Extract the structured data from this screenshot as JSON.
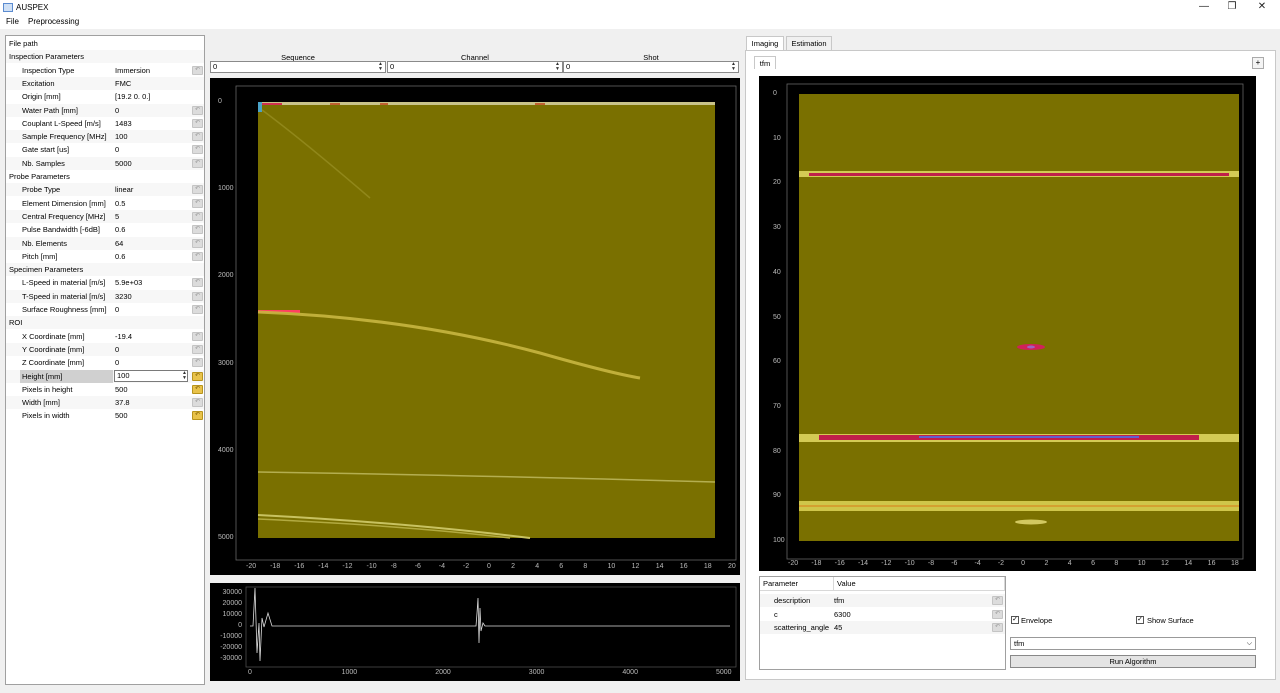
{
  "window": {
    "title": "AUSPEX",
    "minimize": "—",
    "maximize": "❐",
    "close": "✕"
  },
  "menu": {
    "file": "File",
    "preprocessing": "Preprocessing"
  },
  "params": {
    "rows": [
      {
        "label": "File path",
        "value": "",
        "group": true
      },
      {
        "label": "Inspection Parameters",
        "value": "",
        "group": true
      },
      {
        "label": "Inspection Type",
        "value": "Immersion",
        "reset": true
      },
      {
        "label": "Excitation",
        "value": "FMC"
      },
      {
        "label": "Origin [mm]",
        "value": "[19.2  0.  0.]"
      },
      {
        "label": "Water Path [mm]",
        "value": "0",
        "reset": true
      },
      {
        "label": "Couplant L-Speed [m/s]",
        "value": "1483",
        "reset": true
      },
      {
        "label": "Sample Frequency [MHz]",
        "value": "100",
        "reset": true
      },
      {
        "label": "Gate start [us]",
        "value": "0",
        "reset": true
      },
      {
        "label": "Nb. Samples",
        "value": "5000",
        "reset": true
      },
      {
        "label": "Probe Parameters",
        "value": "",
        "group": true
      },
      {
        "label": "Probe Type",
        "value": "linear",
        "reset": true
      },
      {
        "label": "Element Dimension [mm]",
        "value": "0.5",
        "reset": true
      },
      {
        "label": "Central Frequency [MHz]",
        "value": "5",
        "reset": true
      },
      {
        "label": "Pulse Bandwidth [-6dB]",
        "value": "0.6",
        "reset": true
      },
      {
        "label": "Nb. Elements",
        "value": "64",
        "reset": true
      },
      {
        "label": "Pitch [mm]",
        "value": "0.6",
        "reset": true
      },
      {
        "label": "Specimen Parameters",
        "value": "",
        "group": true
      },
      {
        "label": "L-Speed in material [m/s]",
        "value": "5.9e+03",
        "reset": true
      },
      {
        "label": "T-Speed in material [m/s]",
        "value": "3230",
        "reset": true
      },
      {
        "label": "Surface Roughness [mm]",
        "value": "0",
        "reset": true
      },
      {
        "label": "ROI",
        "value": "",
        "group": true
      },
      {
        "label": "X Coordinate [mm]",
        "value": "-19.4",
        "reset": true
      },
      {
        "label": "Y Coordinate [mm]",
        "value": "0",
        "reset": true
      },
      {
        "label": "Z Coordinate [mm]",
        "value": "0",
        "reset": true
      },
      {
        "label": "Height [mm]",
        "value": "100",
        "reset": true,
        "active": true,
        "editing": true
      },
      {
        "label": "Pixels in height",
        "value": "500",
        "reset": true,
        "active": true
      },
      {
        "label": "Width [mm]",
        "value": "37.8",
        "reset": true
      },
      {
        "label": "Pixels in width",
        "value": "500",
        "reset": true,
        "active": true
      }
    ]
  },
  "selectors": {
    "sequence_label": "Sequence",
    "sequence_value": "0",
    "channel_label": "Channel",
    "channel_value": "0",
    "shot_label": "Shot",
    "shot_value": "0"
  },
  "bscan": {
    "y_ticks": [
      "0",
      "1000",
      "2000",
      "3000",
      "4000",
      "5000"
    ],
    "x_ticks": [
      "-20",
      "-18",
      "-16",
      "-14",
      "-12",
      "-10",
      "-8",
      "-6",
      "-4",
      "-2",
      "0",
      "2",
      "4",
      "6",
      "8",
      "10",
      "12",
      "14",
      "16",
      "18",
      "20"
    ]
  },
  "ascan": {
    "y_ticks": [
      "30000",
      "20000",
      "10000",
      "0",
      "-10000",
      "-20000",
      "-30000"
    ],
    "x_ticks": [
      "0",
      "1000",
      "2000",
      "3000",
      "4000",
      "5000"
    ]
  },
  "tabs": {
    "imaging": "Imaging",
    "estimation": "Estimation",
    "tfm": "tfm",
    "add": "+"
  },
  "tfm_image": {
    "y_ticks": [
      "0",
      "10",
      "20",
      "30",
      "40",
      "50",
      "60",
      "70",
      "80",
      "90",
      "100"
    ],
    "x_ticks": [
      "-20",
      "-18",
      "-16",
      "-14",
      "-12",
      "-10",
      "-8",
      "-6",
      "-4",
      "-2",
      "0",
      "2",
      "4",
      "6",
      "8",
      "10",
      "12",
      "14",
      "16",
      "18"
    ]
  },
  "algo_params": {
    "header_param": "Parameter",
    "header_value": "Value",
    "rows": [
      {
        "key": "description",
        "value": "tfm"
      },
      {
        "key": "c",
        "value": "6300"
      },
      {
        "key": "scattering_angle",
        "value": "45"
      }
    ]
  },
  "options": {
    "envelope_label": "Envelope",
    "envelope_checked": true,
    "surface_label": "Show Surface",
    "surface_checked": true
  },
  "algorithm": {
    "selected": "tfm",
    "run_label": "Run Algorithm"
  },
  "colors": {
    "image_bg": "#7a7000",
    "plot_bg": "#000000",
    "highlight": "#c0204a"
  }
}
